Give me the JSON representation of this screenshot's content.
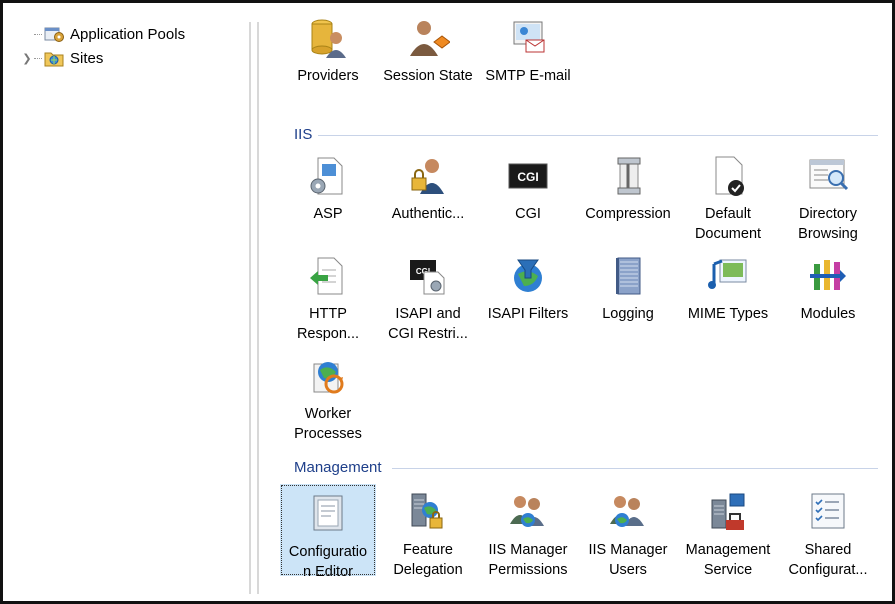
{
  "tree": {
    "items": [
      {
        "label": "Application Pools",
        "icon": "application-pools-icon"
      },
      {
        "label": "Sites",
        "icon": "sites-icon"
      }
    ]
  },
  "top_row": [
    {
      "label": "Providers",
      "icon": "providers-icon"
    },
    {
      "label": "Session State",
      "icon": "session-state-icon"
    },
    {
      "label": "SMTP E-mail",
      "icon": "smtp-email-icon"
    }
  ],
  "groups": {
    "iis": {
      "title": "IIS",
      "items": [
        {
          "l1": "ASP",
          "l2": "",
          "icon": "asp-icon"
        },
        {
          "l1": "Authentic...",
          "l2": "",
          "icon": "authentication-icon"
        },
        {
          "l1": "CGI",
          "l2": "",
          "icon": "cgi-icon"
        },
        {
          "l1": "Compression",
          "l2": "",
          "icon": "compression-icon"
        },
        {
          "l1": "Default",
          "l2": "Document",
          "icon": "default-document-icon"
        },
        {
          "l1": "Directory",
          "l2": "Browsing",
          "icon": "directory-browsing-icon"
        },
        {
          "l1": "HTTP",
          "l2": "Respon...",
          "icon": "http-response-icon"
        },
        {
          "l1": "ISAPI and",
          "l2": "CGI Restri...",
          "icon": "isapi-cgi-restrictions-icon"
        },
        {
          "l1": "ISAPI Filters",
          "l2": "",
          "icon": "isapi-filters-icon"
        },
        {
          "l1": "Logging",
          "l2": "",
          "icon": "logging-icon"
        },
        {
          "l1": "MIME Types",
          "l2": "",
          "icon": "mime-types-icon"
        },
        {
          "l1": "Modules",
          "l2": "",
          "icon": "modules-icon"
        },
        {
          "l1": "Worker",
          "l2": "Processes",
          "icon": "worker-processes-icon"
        }
      ]
    },
    "management": {
      "title": "Management",
      "items": [
        {
          "l1": "Configuratio",
          "l2": "n Editor",
          "icon": "configuration-editor-icon"
        },
        {
          "l1": "Feature",
          "l2": "Delegation",
          "icon": "feature-delegation-icon"
        },
        {
          "l1": "IIS Manager",
          "l2": "Permissions",
          "icon": "iis-manager-permissions-icon"
        },
        {
          "l1": "IIS Manager",
          "l2": "Users",
          "icon": "iis-manager-users-icon"
        },
        {
          "l1": "Management",
          "l2": "Service",
          "icon": "management-service-icon"
        },
        {
          "l1": "Shared",
          "l2": "Configurat...",
          "icon": "shared-configuration-icon"
        }
      ]
    }
  },
  "colors": {
    "group_header": "#1e3f8a",
    "selection": "#cce4f7"
  }
}
